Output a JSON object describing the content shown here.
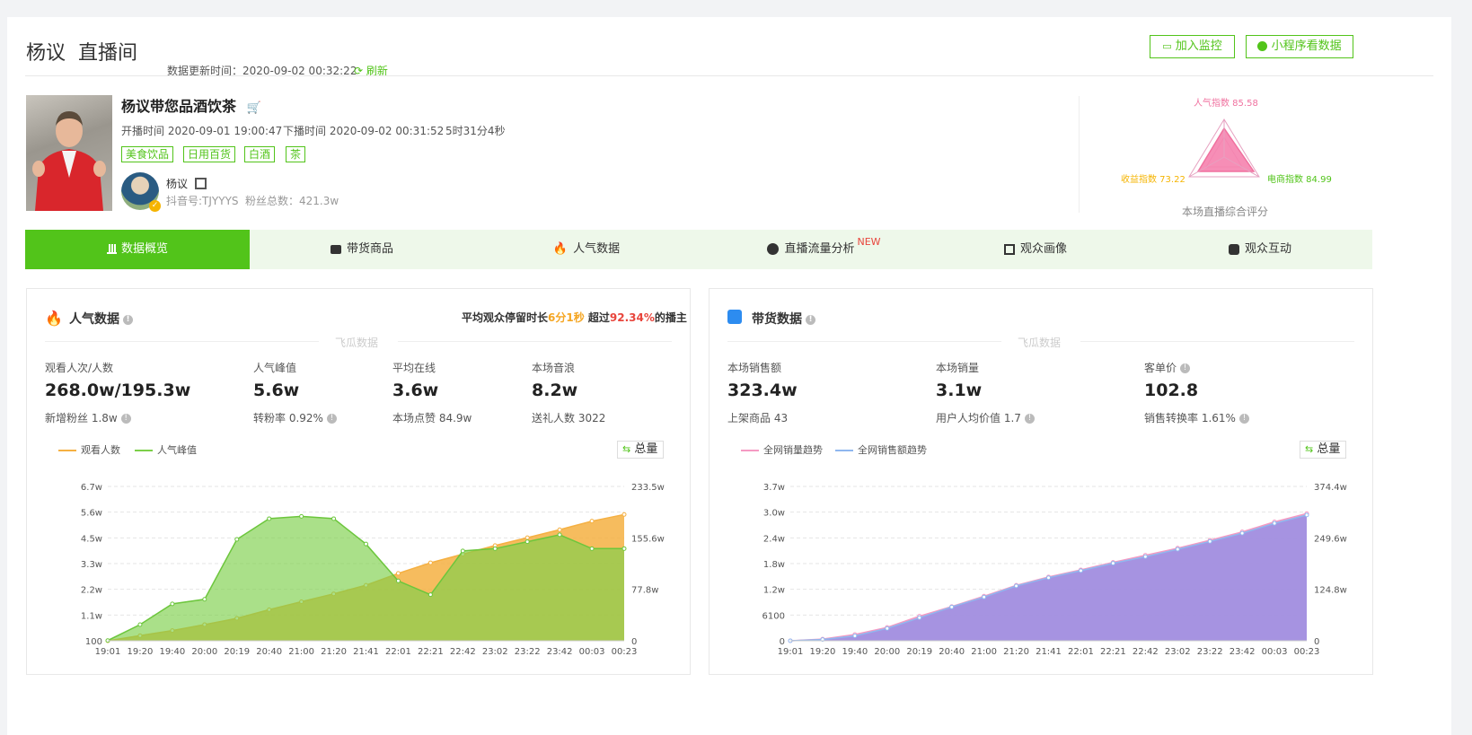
{
  "header": {
    "name": "杨议",
    "title": "直播间",
    "update_label": "数据更新时间：2020-09-02 00:32:22",
    "refresh_label": "刷新",
    "monitor_button": "加入监控",
    "miniapp_button": "小程序看数据"
  },
  "room": {
    "title": "杨议带您品酒饮茶",
    "start_time": "开播时间 2020-09-01 19:00:47",
    "end_time": "下播时间 2020-09-02 00:31:52",
    "duration": "5时31分4秒",
    "tags": [
      "美食饮品",
      "日用百货",
      "白酒",
      "茶"
    ],
    "host_name": "杨议",
    "douyin_id": "抖音号:TJYYYS",
    "fans": "粉丝总数：421.3w"
  },
  "score": {
    "popularity": "人气指数 85.58",
    "income": "收益指数 73.22",
    "ecommerce": "电商指数 84.99",
    "caption": "本场直播综合评分",
    "values": {
      "popularity": 85.58,
      "income": 73.22,
      "ecommerce": 84.99
    }
  },
  "tabs": [
    {
      "label": "数据概览",
      "icon": "bar-chart-icon",
      "active": true
    },
    {
      "label": "带货商品",
      "icon": "basket-icon"
    },
    {
      "label": "人气数据",
      "icon": "fire-icon"
    },
    {
      "label": "直播流量分析",
      "icon": "wave-icon",
      "badge": "NEW"
    },
    {
      "label": "观众画像",
      "icon": "face-scan-icon"
    },
    {
      "label": "观众互动",
      "icon": "interaction-icon"
    }
  ],
  "popularity": {
    "title": "人气数据",
    "avg_prefix": "平均观众停留时长",
    "avg_time": "6分1秒",
    "avg_mid": " 超过",
    "avg_percent": "92.34%",
    "avg_suffix": "的播主",
    "watermark": "飞瓜数据",
    "stats": [
      {
        "label": "观看人次/人数",
        "value": "268.0w/195.3w",
        "sub": "新增粉丝 1.8w"
      },
      {
        "label": "人气峰值",
        "value": "5.6w",
        "sub": "转粉率 0.92%"
      },
      {
        "label": "平均在线",
        "value": "3.6w",
        "sub": "本场点赞 84.9w"
      },
      {
        "label": "本场音浪",
        "value": "8.2w",
        "sub": "送礼人数 3022"
      }
    ],
    "legend": [
      "观看人数",
      "人气峰值"
    ],
    "total_button": "总量"
  },
  "sales": {
    "title": "带货数据",
    "watermark": "飞瓜数据",
    "stats": [
      {
        "label": "本场销售额",
        "value": "323.4w",
        "sub": "上架商品 43"
      },
      {
        "label": "本场销量",
        "value": "3.1w",
        "sub": "用户人均价值 1.7"
      },
      {
        "label": "客单价",
        "value": "102.8",
        "sub": "销售转换率 1.61%"
      }
    ],
    "legend": [
      "全网销量趋势",
      "全网销售额趋势"
    ],
    "total_button": "总量"
  },
  "chart_data": [
    {
      "type": "area",
      "x": [
        "19:01",
        "19:20",
        "19:40",
        "20:00",
        "20:19",
        "20:40",
        "21:00",
        "21:20",
        "21:41",
        "22:01",
        "22:21",
        "22:42",
        "23:02",
        "23:22",
        "23:42",
        "00:03",
        "00:23"
      ],
      "y_left_ticks": [
        "100",
        "1.1w",
        "2.2w",
        "3.3w",
        "4.5w",
        "5.6w",
        "6.7w"
      ],
      "y_right_ticks": [
        "0",
        "77.8w",
        "155.6w",
        "233.5w"
      ],
      "ylim_left": [
        0,
        67000
      ],
      "ylim_right": [
        0,
        2335000
      ],
      "grid": true,
      "legend": "top-left",
      "colors": {
        "watch": "#f5b042",
        "peak": "#7ccf49"
      },
      "series": [
        {
          "name": "观看人数",
          "axis": "right",
          "values": [
            0,
            77000,
            155000,
            245000,
            340000,
            470000,
            590000,
            710000,
            840000,
            1020000,
            1180000,
            1310000,
            1440000,
            1560000,
            1680000,
            1810000,
            1910000
          ]
        },
        {
          "name": "人气峰值",
          "axis": "left",
          "values": [
            100,
            7000,
            16000,
            18000,
            44000,
            53000,
            54000,
            53000,
            42000,
            26000,
            20000,
            39000,
            40000,
            43000,
            46000,
            40000,
            40000
          ]
        }
      ]
    },
    {
      "type": "area",
      "x": [
        "19:01",
        "19:20",
        "19:40",
        "20:00",
        "20:19",
        "20:40",
        "21:00",
        "21:20",
        "21:41",
        "22:01",
        "22:21",
        "22:42",
        "23:02",
        "23:22",
        "23:42",
        "00:03",
        "00:23"
      ],
      "y_left_ticks": [
        "0",
        "6100",
        "1.2w",
        "1.8w",
        "2.4w",
        "3.0w",
        "3.7w"
      ],
      "y_right_ticks": [
        "0",
        "124.8w",
        "249.6w",
        "374.4w"
      ],
      "ylim_left": [
        0,
        37000
      ],
      "ylim_right": [
        0,
        3744000
      ],
      "grid": true,
      "legend": "top-left",
      "colors": {
        "volume": "#f59ac3",
        "amount": "#8b8ee8"
      },
      "series": [
        {
          "name": "全网销量趋势",
          "axis": "left",
          "values": [
            0,
            400,
            1500,
            3200,
            5900,
            8200,
            10700,
            13300,
            15300,
            17000,
            18800,
            20500,
            22200,
            24100,
            26100,
            28500,
            30500
          ]
        },
        {
          "name": "全网销售额趋势",
          "axis": "right",
          "values": [
            0,
            30000,
            120000,
            300000,
            560000,
            820000,
            1060000,
            1330000,
            1530000,
            1700000,
            1880000,
            2040000,
            2220000,
            2410000,
            2610000,
            2850000,
            3050000
          ]
        }
      ]
    }
  ]
}
